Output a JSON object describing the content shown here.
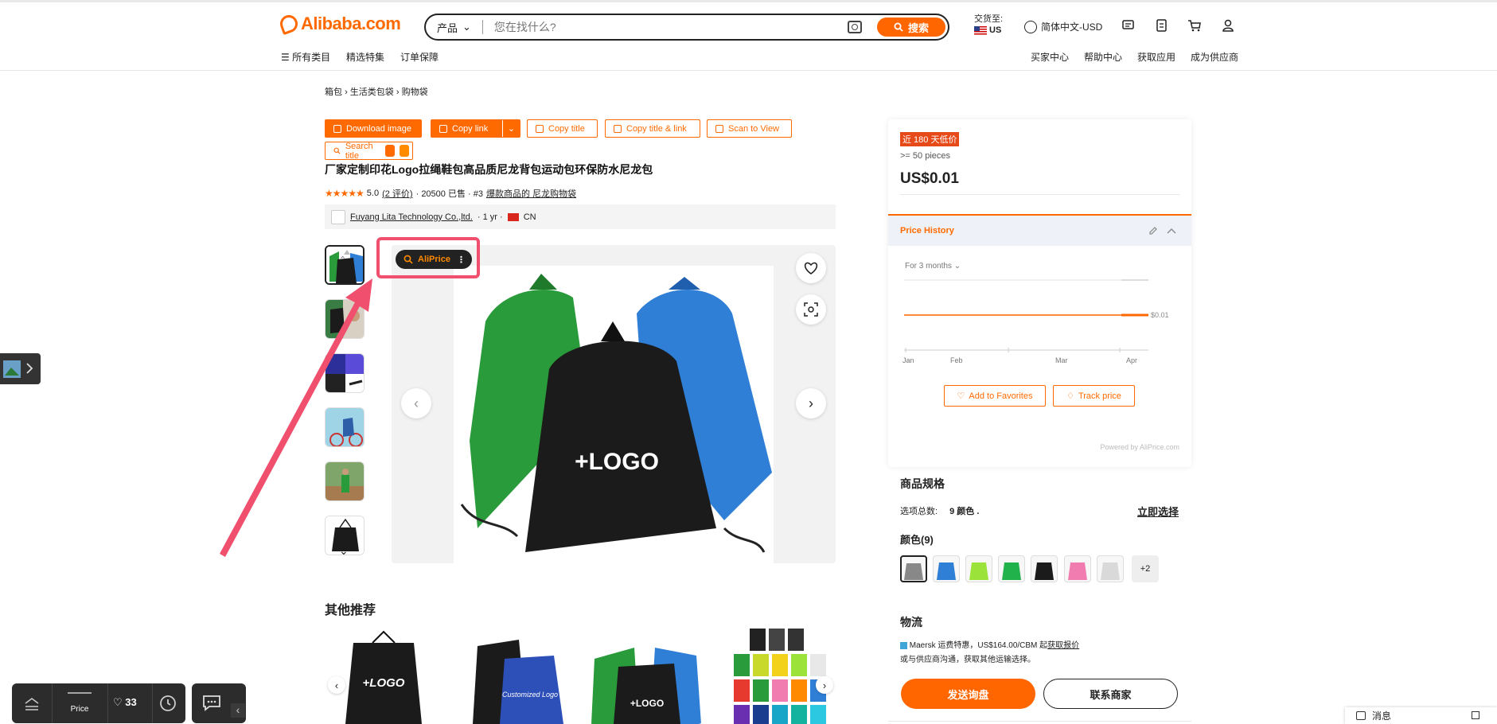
{
  "header": {
    "logo_text": "Alibaba.com",
    "search": {
      "category": "产品",
      "placeholder": "您在找什么?",
      "button_label": "搜索"
    },
    "deliver_to_label": "交货至:",
    "deliver_to_country": "US",
    "language": "简体中文-USD",
    "nav_left": [
      "所有类目",
      "精选特集",
      "订单保障"
    ],
    "nav_right": [
      "买家中心",
      "帮助中心",
      "获取应用",
      "成为供应商"
    ]
  },
  "breadcrumb": [
    "箱包",
    "生活类包袋",
    "购物袋"
  ],
  "toolbar": {
    "download_image": "Download image",
    "copy_link": "Copy link",
    "copy_title": "Copy title",
    "copy_title_link": "Copy title & link",
    "scan_to_view": "Scan to View",
    "search_title": "Search title"
  },
  "product": {
    "title": "厂家定制印花Logo拉绳鞋包高品质尼龙背包运动包环保防水尼龙包",
    "rating": "5.0",
    "reviews": "(2 评价)",
    "sold": "· 20500 已售 · #3",
    "rank_link": "爆款商品的 尼龙购物袋",
    "supplier_name": "Fuyang Lita Technology Co.,ltd.",
    "supplier_years": "· 1 yr ·",
    "supplier_country": "CN",
    "image_logo_text": "+LOGO"
  },
  "aliprice_button": "AliPrice",
  "price_panel": {
    "badge": "近 180 天低价",
    "moq": ">= 50 pieces",
    "price": "US$0.01",
    "history_title": "Price History",
    "range_select": "For 3 months",
    "chart_end_label": "$0.01",
    "chart_x_labels": [
      "Jan",
      "Feb",
      "Mar",
      "Apr"
    ],
    "add_favorites": "Add to Favorites",
    "track_price": "Track price",
    "powered_by": "Powered by AliPrice.com"
  },
  "specs": {
    "title": "商品规格",
    "options_label": "选项总数:",
    "options_value": "9 颜色 .",
    "select_now": "立即选择",
    "color_title": "颜色(9)",
    "more_colors": "+2",
    "swatch_colors": [
      "#888888",
      "#2f7fd6",
      "#9be23a",
      "#22b24c",
      "#1b1b1b",
      "#f07cb0",
      "#d9d9d9"
    ]
  },
  "logistics": {
    "title": "物流",
    "line1": "Maersk 运费特惠，US$164.00/CBM 起",
    "line1_link": "获取报价",
    "line2": "或与供应商沟通，获取其他运输选择。"
  },
  "actions": {
    "inquiry": "发送询盘",
    "contact": "联系商家"
  },
  "recommend_title": "其他推荐",
  "recommend_cards": [
    {
      "text": "+LOGO"
    },
    {
      "text": "Customized Logo"
    },
    {
      "text": "+LOGO"
    },
    {
      "text": ""
    }
  ],
  "bottom_bar": {
    "price_label": "Price",
    "likes": "33"
  },
  "message_bar": "消息",
  "colors": {
    "accent": "#ff6a00",
    "highlight": "#f0506e"
  }
}
